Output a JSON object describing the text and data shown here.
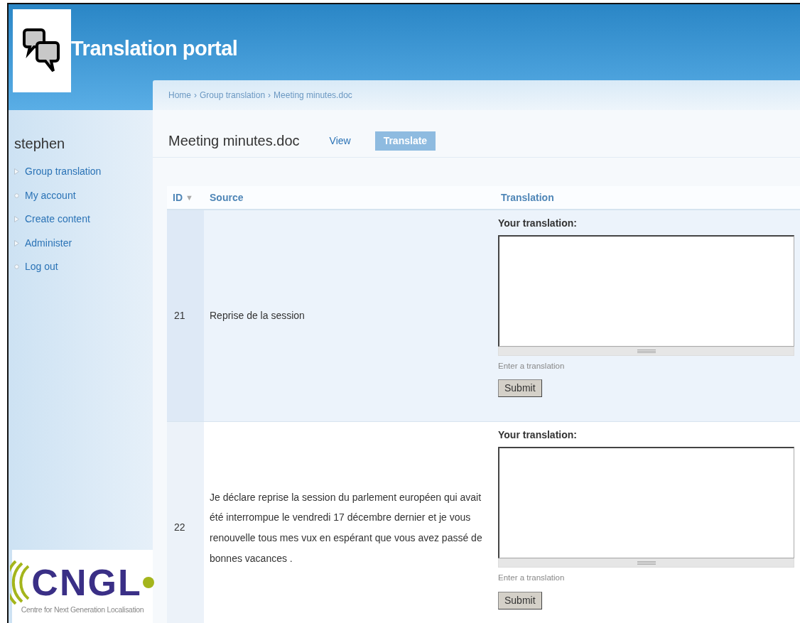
{
  "site": {
    "title": "Translation portal"
  },
  "breadcrumb": [
    "Home",
    "Group translation",
    "Meeting minutes.doc"
  ],
  "breadcrumb_separator": "›",
  "sidebar": {
    "user": "stephen",
    "items": [
      {
        "label": "Group translation",
        "kind": "collapsed"
      },
      {
        "label": "My account",
        "kind": "leaf"
      },
      {
        "label": "Create content",
        "kind": "collapsed"
      },
      {
        "label": "Administer",
        "kind": "collapsed"
      },
      {
        "label": "Log out",
        "kind": "leaf"
      }
    ],
    "sponsor_logo": {
      "wordmark": "CNGL",
      "tagline": "Centre for Next Generation Localisation"
    }
  },
  "page": {
    "title": "Meeting minutes.doc",
    "tabs": [
      {
        "label": "View",
        "selected": false
      },
      {
        "label": "Translate",
        "selected": true
      }
    ]
  },
  "table": {
    "columns": [
      {
        "label": "ID",
        "sort_indicator": "▼"
      },
      {
        "label": "Source"
      },
      {
        "label": "Translation"
      }
    ],
    "rows": [
      {
        "id": "21",
        "source": "Reprise de la session",
        "field_label": "Your translation:",
        "description": "Enter a translation",
        "button": "Submit"
      },
      {
        "id": "22",
        "source": "Je déclare reprise la session du parlement européen qui avait été interrompue le vendredi 17 décembre dernier et je vous renouvelle tous mes vux en espérant que vous avez passé de bonnes vacances .",
        "field_label": "Your translation:",
        "description": "Enter a translation",
        "button": "Submit"
      }
    ]
  }
}
